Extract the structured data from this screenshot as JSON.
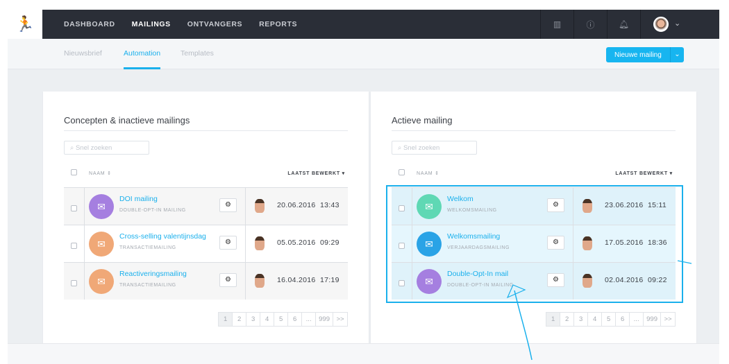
{
  "nav": {
    "items": [
      "DASHBOARD",
      "MAILINGS",
      "ONTVANGERS",
      "REPORTS"
    ],
    "active": "MAILINGS"
  },
  "subnav": {
    "tabs": [
      "Nieuwsbrief",
      "Automation",
      "Templates"
    ],
    "active": "Automation",
    "new_button": "Nieuwe mailing"
  },
  "left": {
    "title": "Concepten & inactieve mailings",
    "search_placeholder": "Snel zoeken",
    "col_name": "NAAM ⇕",
    "col_date": "LAATST BEWERKT ▾",
    "rows": [
      {
        "title": "DOI mailing",
        "subtitle": "DOUBLE-OPT-IN MAILING",
        "date": "20.06.2016  13:43",
        "color": "#a57fe0"
      },
      {
        "title": "Cross-selling valentijnsdag",
        "subtitle": "TRANSACTIEMAILING",
        "date": "05.05.2016  09:29",
        "color": "#f0a877"
      },
      {
        "title": "Reactiveringsmailing",
        "subtitle": "TRANSACTIEMAILING",
        "date": "16.04.2016  17:19",
        "color": "#f0a877"
      }
    ],
    "pages": [
      "1",
      "2",
      "3",
      "4",
      "5",
      "6",
      "...",
      "999",
      ">>"
    ]
  },
  "right": {
    "title": "Actieve mailing",
    "search_placeholder": "Snel zoeken",
    "col_name": "NAAM ⇕",
    "col_date": "LAATST BEWERKT ▾",
    "rows": [
      {
        "title": "Welkom",
        "subtitle": "WELKOMSMAILING",
        "date": "23.06.2016  15:11",
        "color": "#5fd8b4"
      },
      {
        "title": "Welkomsmailing",
        "subtitle": "VERJAARDAGSMAILING",
        "date": "17.05.2016  18:36",
        "color": "#2aa3e6"
      },
      {
        "title": "Double-Opt-In mail",
        "subtitle": "DOUBLE-OPT-IN MAILING",
        "date": "02.04.2016  09:22",
        "color": "#a57fe0"
      }
    ],
    "pages": [
      "1",
      "2",
      "3",
      "4",
      "5",
      "6",
      "...",
      "999",
      ">>"
    ]
  }
}
